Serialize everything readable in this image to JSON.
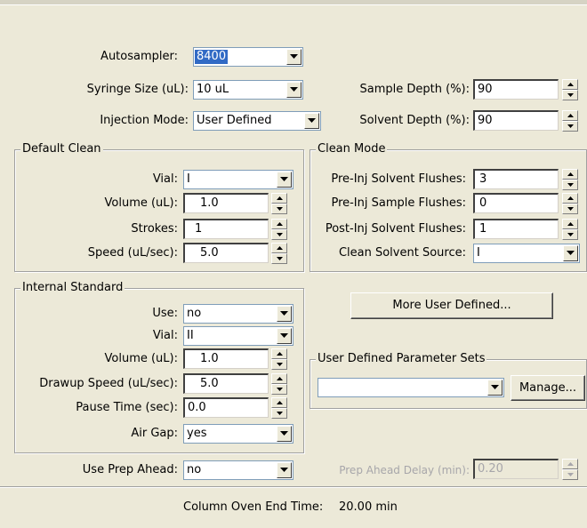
{
  "top": {
    "autosampler_label": "Autosampler:",
    "autosampler_value": "8400",
    "syringe_label": "Syringe Size (uL):",
    "syringe_value": "10 uL",
    "injection_label": "Injection Mode:",
    "injection_value": "User Defined",
    "sample_depth_label": "Sample Depth (%):",
    "sample_depth_value": "90",
    "solvent_depth_label": "Solvent Depth (%):",
    "solvent_depth_value": "90"
  },
  "default_clean": {
    "title": "Default Clean",
    "vial_label": "Vial:",
    "vial_value": "I",
    "volume_label": "Volume (uL):",
    "volume_value": "1.0",
    "strokes_label": "Strokes:",
    "strokes_value": "1",
    "speed_label": "Speed (uL/sec):",
    "speed_value": "5.0"
  },
  "clean_mode": {
    "title": "Clean Mode",
    "pre_solvent_label": "Pre-Inj Solvent Flushes:",
    "pre_solvent_value": "3",
    "pre_sample_label": "Pre-Inj Sample Flushes:",
    "pre_sample_value": "0",
    "post_solvent_label": "Post-Inj Solvent Flushes:",
    "post_solvent_value": "1",
    "source_label": "Clean Solvent Source:",
    "source_value": "I"
  },
  "internal_standard": {
    "title": "Internal Standard",
    "use_label": "Use:",
    "use_value": "no",
    "vial_label": "Vial:",
    "vial_value": "II",
    "volume_label": "Volume (uL):",
    "volume_value": "1.0",
    "drawup_label": "Drawup Speed (uL/sec):",
    "drawup_value": "5.0",
    "pause_label": "Pause Time (sec):",
    "pause_value": "0.0",
    "airgap_label": "Air Gap:",
    "airgap_value": "yes"
  },
  "more_button": "More User Defined...",
  "param_sets": {
    "title": "User Defined Parameter Sets",
    "value": "",
    "manage_label": "Manage..."
  },
  "prep": {
    "use_label": "Use Prep Ahead:",
    "use_value": "no",
    "delay_label": "Prep Ahead Delay (min):",
    "delay_value": "0.20"
  },
  "footer": {
    "oven_label": "Column Oven End Time:",
    "oven_value": "20.00 min"
  }
}
